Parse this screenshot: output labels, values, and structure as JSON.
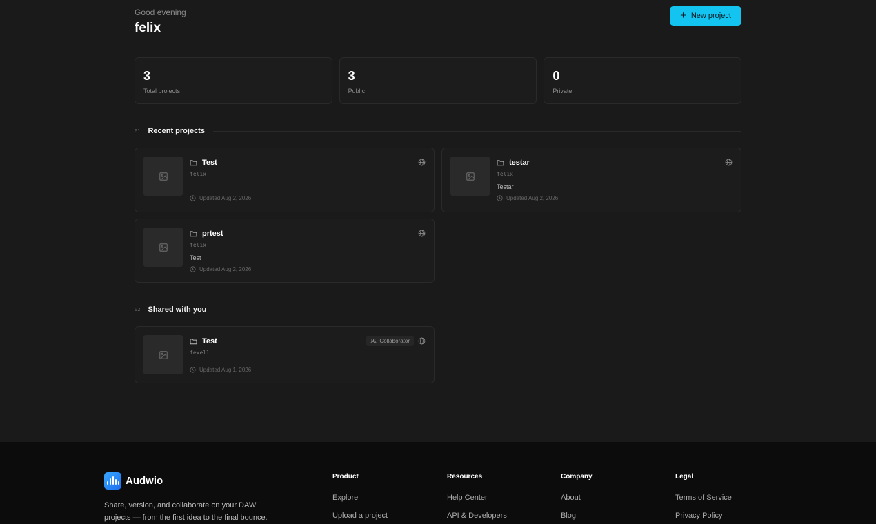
{
  "header": {
    "greeting": "Good evening",
    "username": "felix",
    "new_project_label": "New project"
  },
  "stats": [
    {
      "value": "3",
      "label": "Total projects"
    },
    {
      "value": "3",
      "label": "Public"
    },
    {
      "value": "0",
      "label": "Private"
    }
  ],
  "recent": {
    "index": "01",
    "title": "Recent projects",
    "projects": [
      {
        "name": "Test",
        "owner": "felix",
        "description": "",
        "updated": "Updated Aug 2, 2026",
        "visibility_icon": "globe-icon"
      },
      {
        "name": "testar",
        "owner": "felix",
        "description": "Testar",
        "updated": "Updated Aug 2, 2026",
        "visibility_icon": "globe-icon"
      },
      {
        "name": "prtest",
        "owner": "felix",
        "description": "Test",
        "updated": "Updated Aug 2, 2026",
        "visibility_icon": "globe-icon"
      }
    ]
  },
  "shared": {
    "index": "02",
    "title": "Shared with you",
    "projects": [
      {
        "name": "Test",
        "owner": "fexell",
        "description": "",
        "role": "Collaborator",
        "updated": "Updated Aug 1, 2026",
        "visibility_icon": "globe-icon"
      }
    ]
  },
  "footer": {
    "brand": "Audwio",
    "tagline": "Share, version, and collaborate on your DAW projects — from the first idea to the final bounce.",
    "columns": [
      {
        "heading": "Product",
        "links": [
          "Explore",
          "Upload a project"
        ]
      },
      {
        "heading": "Resources",
        "links": [
          "Help Center",
          "API & Developers"
        ]
      },
      {
        "heading": "Company",
        "links": [
          "About",
          "Blog"
        ]
      },
      {
        "heading": "Legal",
        "links": [
          "Terms of Service",
          "Privacy Policy"
        ]
      }
    ]
  },
  "colors": {
    "accent": "#13c4f0",
    "background": "#1a1a1a",
    "card": "#1c1c1c",
    "footer": "#0c0c0c"
  }
}
